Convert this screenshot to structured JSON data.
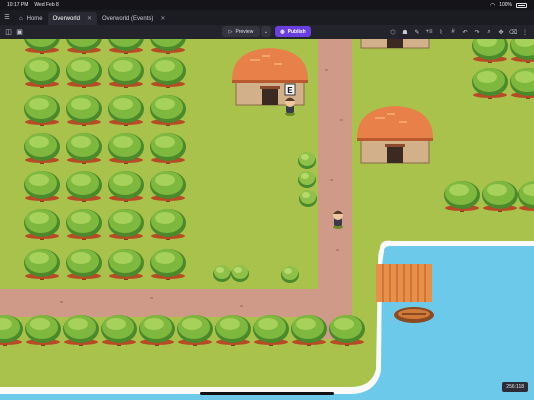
{
  "status_bar": {
    "time": "10:17 PM",
    "date": "Wed Feb 8",
    "battery": "100%"
  },
  "tabs": {
    "home": "Home",
    "overworld": "Overworld",
    "events": "Overworld (Events)"
  },
  "toolbar": {
    "preview": "Preview",
    "publish": "Publish"
  },
  "game": {
    "coordinates": "256:118",
    "house_sign": "E"
  },
  "colors": {
    "grass": "#a8c24c",
    "path": "#d09a88",
    "water": "#6cc9e9",
    "roof": "#e8804a",
    "accent": "#6a3fe0"
  }
}
